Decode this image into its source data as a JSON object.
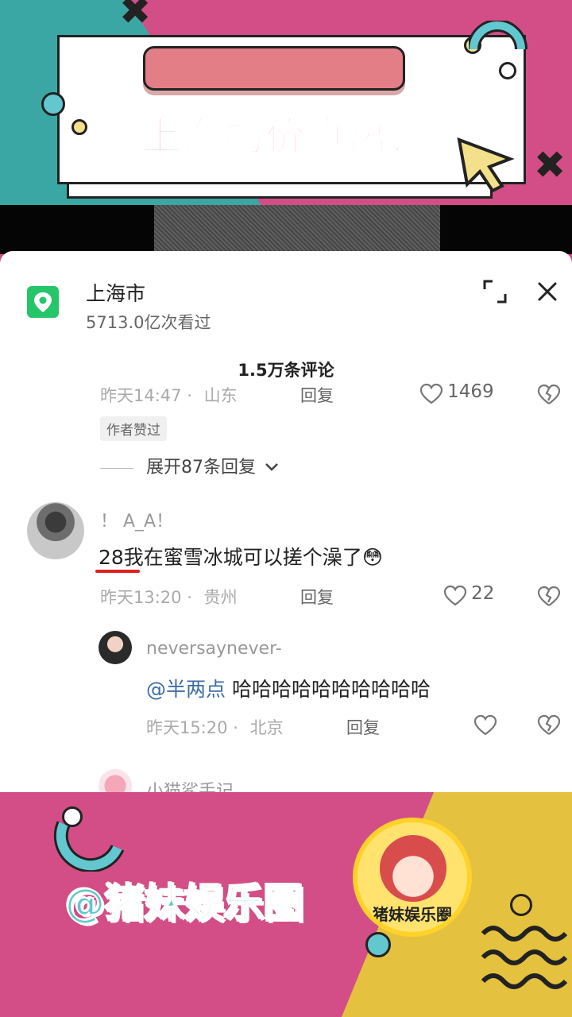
{
  "banner": {
    "title": "上海物价真离谱",
    "handle": "@猪妹娱乐圈",
    "logo_text": "猪妹娱乐圈",
    "colors": {
      "pink": "#d34e86",
      "teal": "#3ba7a5",
      "yellow": "#e4c13e"
    }
  },
  "location": {
    "icon": "map-pin-icon",
    "title": "上海市",
    "views": "5713.0亿次看过"
  },
  "header": {
    "comment_count": "1.5万条评论",
    "expand_icon": "fullscreen-icon",
    "close_icon": "close-icon"
  },
  "comments": {
    "top": {
      "time": "昨天14:47",
      "location": "山东",
      "reply_label": "回复",
      "likes": "1469",
      "tag": "作者赞过",
      "expand_label": "展开87条回复"
    },
    "main": {
      "username": "！ A_A！",
      "text": "28我在蜜雪冰城可以搓个澡了",
      "emoji": "😳",
      "time": "昨天13:20",
      "location": "贵州",
      "reply_label": "回复",
      "likes": "22"
    },
    "reply": {
      "username": "neversaynever-",
      "mention": "@半两点",
      "text": "哈哈哈哈哈哈哈哈哈哈",
      "time": "昨天15:20",
      "location": "北京",
      "reply_label": "回复"
    },
    "next": {
      "username": "小猫鲨手记"
    }
  }
}
